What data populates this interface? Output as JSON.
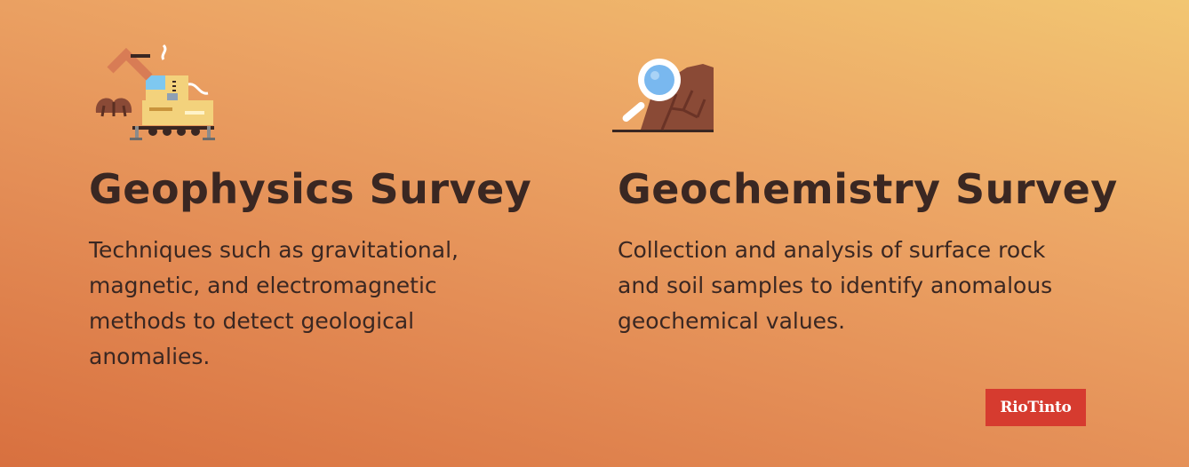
{
  "cards": [
    {
      "icon": "excavator-icon",
      "title": "Geophysics Survey",
      "description": "Techniques such as gravitational, magnetic, and electromagnetic methods to detect geological anomalies."
    },
    {
      "icon": "magnifying-glass-rock-icon",
      "title": "Geochemistry Survey",
      "description": "Collection and analysis of surface rock and soil samples to identify anomalous geochemical values."
    }
  ],
  "logo": {
    "text": "RioTinto",
    "color": "#d63b2f"
  },
  "colors": {
    "text": "#3a2722",
    "gradient_start": "#d8703f",
    "gradient_end": "#f2c672"
  }
}
